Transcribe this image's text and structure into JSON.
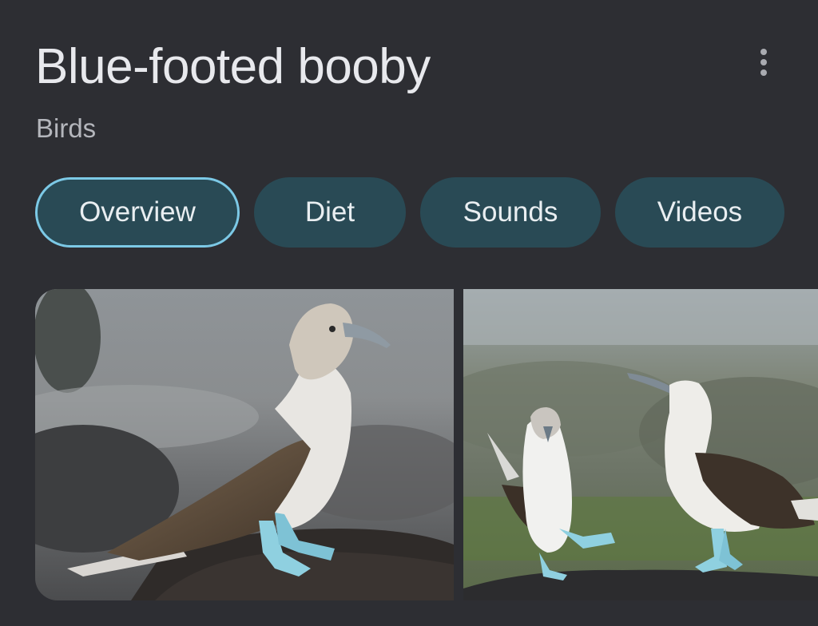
{
  "header": {
    "title": "Blue-footed booby",
    "subtitle": "Birds",
    "more_icon": "more-vertical-icon"
  },
  "tabs": [
    {
      "label": "Overview",
      "active": true
    },
    {
      "label": "Diet",
      "active": false
    },
    {
      "label": "Sounds",
      "active": false
    },
    {
      "label": "Videos",
      "active": false
    }
  ],
  "colors": {
    "background": "#2d2e33",
    "chip": "#294a55",
    "chip_active_border": "#7cc9e6",
    "foot_blue": "#8fd0e0"
  }
}
